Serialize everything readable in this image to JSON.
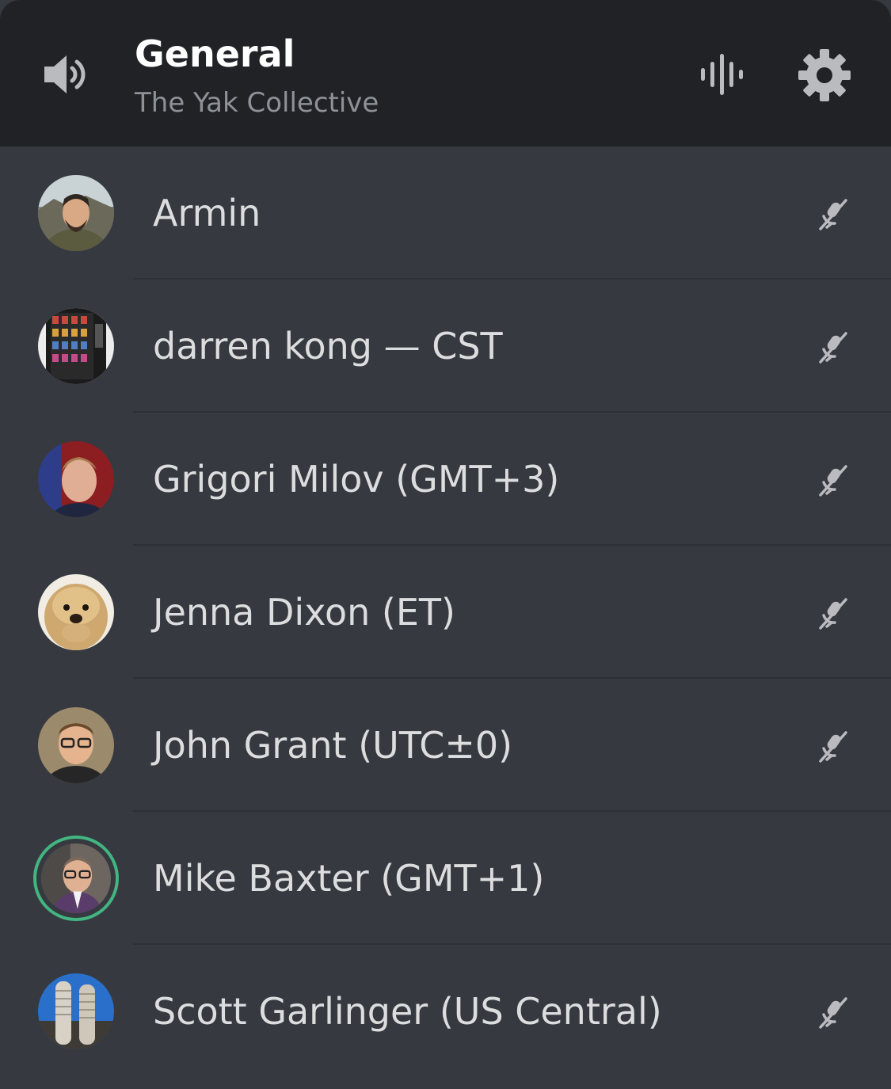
{
  "header": {
    "title": "General",
    "subtitle": "The Yak Collective",
    "channel_icon": "speaker-icon",
    "actions": [
      {
        "name": "voice-activity-icon"
      },
      {
        "name": "gear-icon"
      }
    ]
  },
  "members": [
    {
      "name": "Armin",
      "muted": true,
      "speaking": false,
      "avatar": "avatar-armin"
    },
    {
      "name": "darren kong — CST",
      "muted": true,
      "speaking": false,
      "avatar": "avatar-darren"
    },
    {
      "name": "Grigori Milov (GMT+3)",
      "muted": true,
      "speaking": false,
      "avatar": "avatar-grigori"
    },
    {
      "name": "Jenna Dixon (ET)",
      "muted": true,
      "speaking": false,
      "avatar": "avatar-jenna"
    },
    {
      "name": "John Grant (UTC±0)",
      "muted": true,
      "speaking": false,
      "avatar": "avatar-john"
    },
    {
      "name": "Mike Baxter (GMT+1)",
      "muted": false,
      "speaking": true,
      "avatar": "avatar-mike"
    },
    {
      "name": "Scott Garlinger (US Central)",
      "muted": true,
      "speaking": false,
      "avatar": "avatar-scott"
    }
  ],
  "colors": {
    "header_bg": "#202225",
    "list_bg": "#36393f",
    "speaking_ring": "#43b581",
    "name_text": "#dcddde",
    "subtitle_text": "#8e9297"
  }
}
